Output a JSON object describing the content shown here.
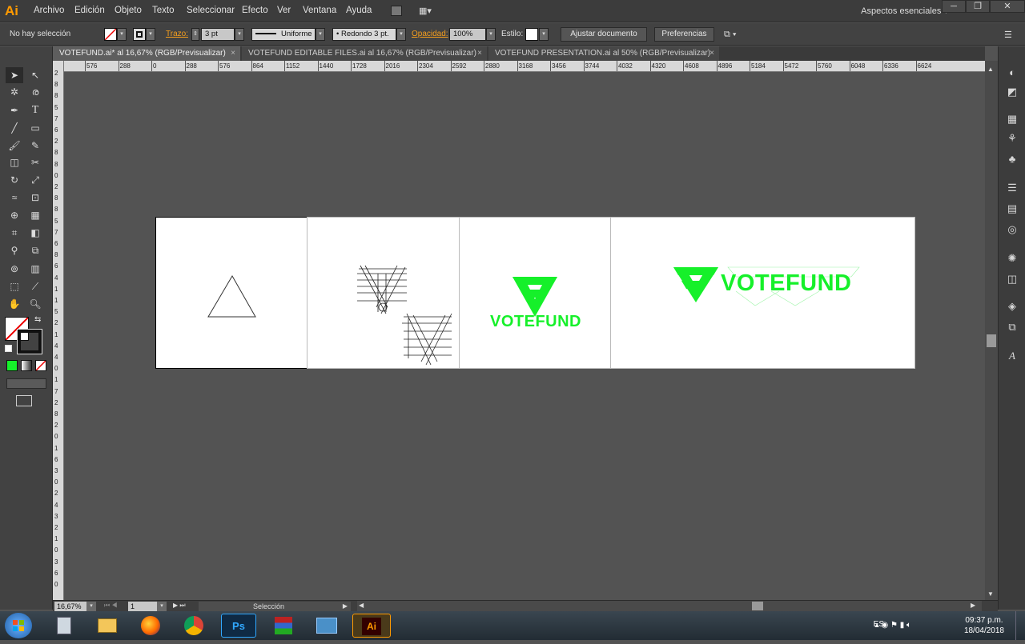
{
  "app": {
    "logo": "Ai",
    "workspace": "Aspectos esenciales"
  },
  "menu": [
    "Archivo",
    "Edición",
    "Objeto",
    "Texto",
    "Seleccionar",
    "Efecto",
    "Ver",
    "Ventana",
    "Ayuda"
  ],
  "window_controls": [
    "─",
    "❐",
    "✕"
  ],
  "control": {
    "selection": "No hay selección",
    "stroke_label": "Trazo:",
    "stroke_value": "3 pt",
    "profile": "Uniforme",
    "brush": "• Redondo 3 pt.",
    "opacity_label": "Opacidad:",
    "opacity_value": "100%",
    "style_label": "Estilo:",
    "fit_button": "Ajustar documento",
    "prefs_button": "Preferencias"
  },
  "tabs": [
    {
      "label": "VOTEFUND.ai* al 16,67% (RGB/Previsualizar)",
      "close": "×"
    },
    {
      "label": "VOTEFUND EDITABLE FILES.ai al 16,67% (RGB/Previsualizar)",
      "close": "×"
    },
    {
      "label": "VOTEFUND PRESENTATION.ai al 50% (RGB/Previsualizar)",
      "close": "×"
    }
  ],
  "ruler_h": [
    "576",
    "288",
    "0",
    "288",
    "576",
    "864",
    "1152",
    "1440",
    "1728",
    "2016",
    "2304",
    "2592",
    "2880",
    "3168",
    "3456",
    "3744",
    "4032",
    "4320",
    "4608",
    "4896",
    "5184",
    "5472",
    "5760",
    "6048",
    "6336",
    "6624"
  ],
  "ruler_v": [
    "2",
    "8",
    "8",
    "5",
    "7",
    "6",
    "2",
    "8",
    "8",
    "0",
    "2",
    "8",
    "8",
    "5",
    "7",
    "6",
    "8",
    "6",
    "4",
    "1",
    "1",
    "5",
    "2",
    "1",
    "4",
    "4",
    "0",
    "1",
    "7",
    "2",
    "8",
    "2",
    "0",
    "1",
    "6",
    "3",
    "0",
    "2",
    "4",
    "3",
    "2",
    "1",
    "0",
    "3",
    "6",
    "0"
  ],
  "artboards": {
    "logo_text_small": "VOTEFUND",
    "logo_text_large": "VOTEFUND"
  },
  "colors": {
    "brand_green": "#16f02a",
    "ui_dark": "#424242",
    "canvas": "#535353",
    "orange": "#f59e1d"
  },
  "status": {
    "zoom": "16,67%",
    "page": "1",
    "tool": "Selección"
  },
  "taskbar": {
    "lang": "ES",
    "time": "09:37 p.m.",
    "date": "18/04/2018",
    "apps": [
      "start",
      "calculator-icon",
      "folder-icon",
      "firefox-icon",
      "chrome-icon",
      "Ps",
      "winrar-icon",
      "network-icon",
      "Ai"
    ]
  }
}
